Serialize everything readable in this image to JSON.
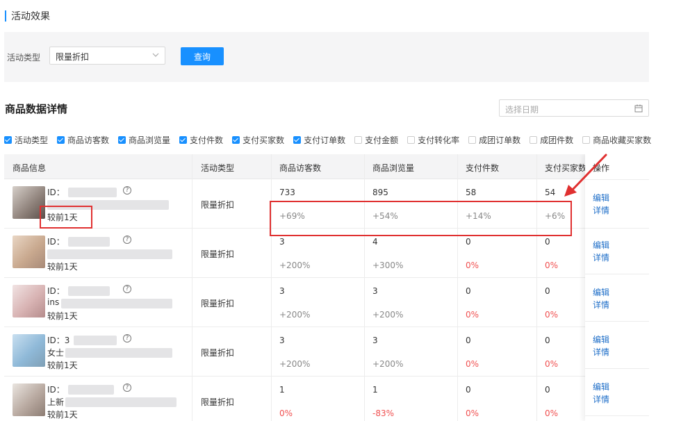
{
  "section": {
    "title": "活动效果"
  },
  "filter": {
    "label": "活动类型",
    "select_value": "限量折扣",
    "query_label": "查询"
  },
  "detail": {
    "title": "商品数据详情",
    "date_placeholder": "选择日期"
  },
  "checkboxes": [
    {
      "label": "活动类型",
      "checked": true
    },
    {
      "label": "商品访客数",
      "checked": true
    },
    {
      "label": "商品浏览量",
      "checked": true
    },
    {
      "label": "支付件数",
      "checked": true
    },
    {
      "label": "支付买家数",
      "checked": true
    },
    {
      "label": "支付订单数",
      "checked": true
    },
    {
      "label": "支付金额",
      "checked": false
    },
    {
      "label": "支付转化率",
      "checked": false
    },
    {
      "label": "成团订单数",
      "checked": false
    },
    {
      "label": "成团件数",
      "checked": false
    },
    {
      "label": "商品收藏买家数",
      "checked": false
    }
  ],
  "table": {
    "headers": {
      "info": "商品信息",
      "type": "活动类型",
      "visitors": "商品访客数",
      "views": "商品浏览量",
      "paid_items": "支付件数",
      "paid_buyers": "支付买家数",
      "ops": "操作"
    },
    "rows": [
      {
        "id_label": "ID：",
        "line2": "",
        "compare": "较前1天",
        "type": "限量折扣",
        "visitors": "733",
        "visitors_pct": "+69%",
        "views": "895",
        "views_pct": "+54%",
        "paid_items": "58",
        "paid_items_pct": "+14%",
        "paid_buyers": "54",
        "paid_buyers_pct": "+6%",
        "edit": "编辑",
        "details": "详情"
      },
      {
        "id_label": "ID：",
        "line2": "",
        "compare": "较前1天",
        "type": "限量折扣",
        "visitors": "3",
        "visitors_pct": "+200%",
        "views": "4",
        "views_pct": "+300%",
        "paid_items": "0",
        "paid_items_pct": "0%",
        "paid_buyers": "0",
        "paid_buyers_pct": "0%",
        "edit": "编辑",
        "details": "详情"
      },
      {
        "id_label": "ID：",
        "line2": "ins",
        "compare": "较前1天",
        "type": "限量折扣",
        "visitors": "3",
        "visitors_pct": "+200%",
        "views": "3",
        "views_pct": "+200%",
        "paid_items": "0",
        "paid_items_pct": "0%",
        "paid_buyers": "0",
        "paid_buyers_pct": "0%",
        "edit": "编辑",
        "details": "详情"
      },
      {
        "id_label": "ID：3",
        "line2": "女士",
        "compare": "较前1天",
        "type": "限量折扣",
        "visitors": "3",
        "visitors_pct": "+200%",
        "views": "3",
        "views_pct": "+200%",
        "paid_items": "0",
        "paid_items_pct": "0%",
        "paid_buyers": "0",
        "paid_buyers_pct": "0%",
        "edit": "编辑",
        "details": "详情"
      },
      {
        "id_label": "ID：",
        "line2": "上新",
        "compare": "较前1天",
        "type": "限量折扣",
        "visitors": "1",
        "visitors_pct": "0%",
        "views": "1",
        "views_pct": "-83%",
        "paid_items": "0",
        "paid_items_pct": "0%",
        "paid_buyers": "0",
        "paid_buyers_pct": "0%",
        "edit": "编辑",
        "details": "详情"
      }
    ]
  },
  "colors": {
    "accent": "#1890ff",
    "annotation": "#e03030",
    "negative": "#f05050",
    "link": "#1e6ec8"
  }
}
